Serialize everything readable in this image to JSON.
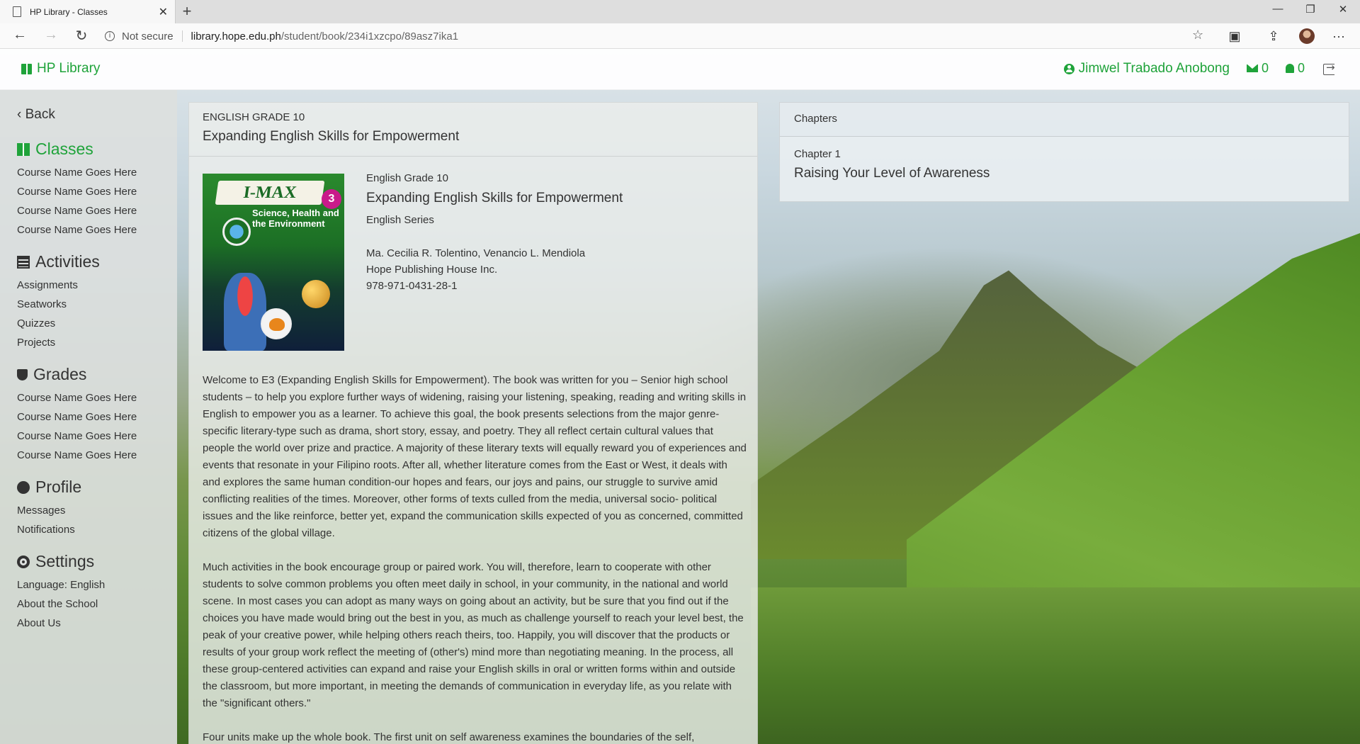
{
  "browser": {
    "tab_title": "HP Library - Classes",
    "security": "Not secure",
    "url_host": "library.hope.edu.ph",
    "url_path": "/student/book/234i1xzcpo/89asz7ika1"
  },
  "header": {
    "brand": "HP Library",
    "user_name": "Jimwel Trabado Anobong",
    "messages_count": "0",
    "notifications_count": "0"
  },
  "sidebar": {
    "back_label": "Back",
    "classes": {
      "title": "Classes",
      "items": [
        "Course Name Goes Here",
        "Course Name Goes Here",
        "Course Name Goes Here",
        "Course Name Goes Here"
      ]
    },
    "activities": {
      "title": "Activities",
      "items": [
        "Assignments",
        "Seatworks",
        "Quizzes",
        "Projects"
      ]
    },
    "grades": {
      "title": "Grades",
      "items": [
        "Course Name Goes Here",
        "Course Name Goes Here",
        "Course Name Goes Here",
        "Course Name Goes Here"
      ]
    },
    "profile": {
      "title": "Profile",
      "items": [
        "Messages",
        "Notifications"
      ]
    },
    "settings": {
      "title": "Settings",
      "items": [
        "Language: English",
        "About the School",
        "About Us"
      ]
    }
  },
  "book": {
    "header_grade": "ENGLISH GRADE 10",
    "header_title": "Expanding English Skills for Empowerment",
    "cover_badge": "I-MAX",
    "cover_subtitle": "Science, Health and the Environment",
    "cover_number": "3",
    "grade": "English Grade 10",
    "title": "Expanding English Skills for Empowerment",
    "series": "English Series",
    "authors": "Ma. Cecilia R. Tolentino, Venancio L. Mendiola",
    "publisher": "Hope Publishing House Inc.",
    "isbn": "978-971-0431-28-1",
    "paragraphs": [
      "Welcome to E3 (Expanding English Skills for Empowerment). The book was written for you – Senior high school students – to help you explore further ways of widening, raising your listening, speaking, reading and writing skills in English to empower you as a learner. To achieve this goal, the book presents selections from the major genre- specific literary-type such as drama, short story, essay, and poetry. They all reflect certain cultural values that people the world over prize and practice. A majority of these literary texts will equally reward you of experiences and events that resonate in your Filipino roots. After all, whether literature comes from the East or West, it deals with and explores the same human condition-our hopes and fears, our joys and pains, our struggle to survive amid conflicting realities of the times. Moreover, other forms of texts culled from the media, universal socio- political issues and the like reinforce, better yet, expand the communication skills expected of you as concerned, committed citizens of the global village.",
      "Much activities in the book encourage group or paired work. You will, therefore, learn to cooperate with other students to solve common problems you often meet daily in school, in your community, in the national and world scene. In most cases you can adopt as many ways on going about an activity, but be sure that you find out if the choices you have made would bring out the best in you, as much as challenge yourself to reach your level best, the peak of your creative power, while helping others reach theirs, too. Happily, you will discover that the products or results of your group work reflect the meeting of (other's) mind more than negotiating meaning. In the process, all these group-centered activities can expand and raise your English skills in oral or written forms within and outside the classroom, but more important, in meeting the demands of communication in everyday life, as you relate with the \"significant others.\"",
      "Four units make up the whole book. The first unit on self awareness examines the boundaries of the self,"
    ]
  },
  "chapters": {
    "header": "Chapters",
    "items": [
      {
        "number": "Chapter 1",
        "title": "Raising Your Level of Awareness"
      }
    ]
  }
}
